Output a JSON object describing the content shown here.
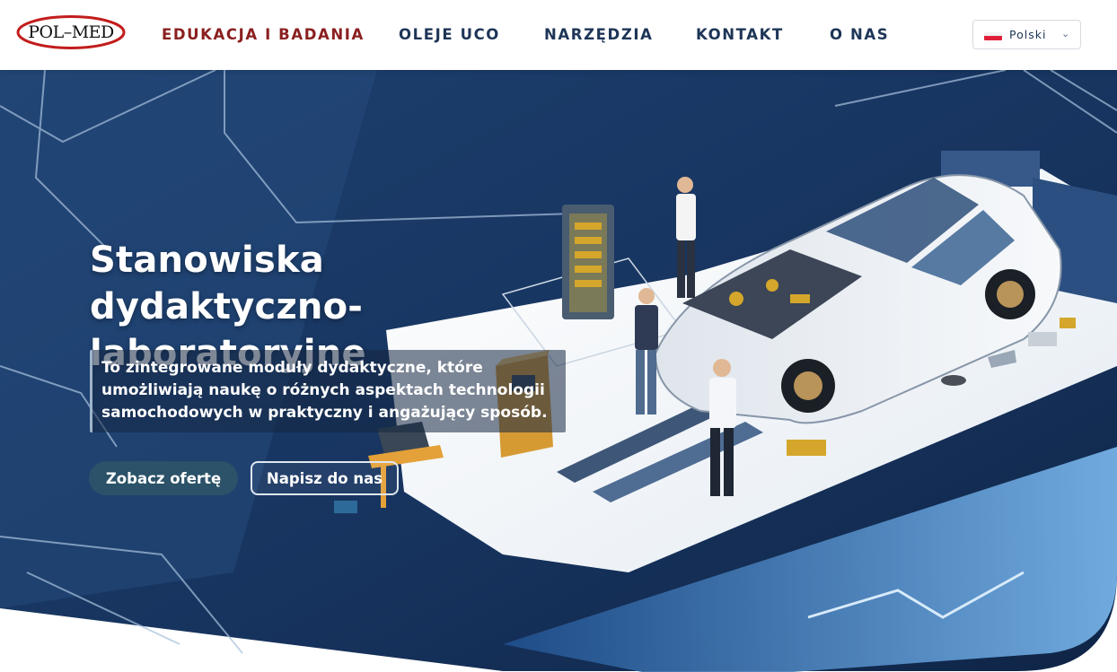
{
  "logo": {
    "text": "POL–MED"
  },
  "nav": {
    "items": [
      {
        "label": "EDUKACJA I BADANIA"
      },
      {
        "label": "OLEJE UCO"
      },
      {
        "label": "NARZĘDZIA"
      },
      {
        "label": "KONTAKT"
      },
      {
        "label": "O NAS"
      }
    ]
  },
  "language": {
    "label": "Polski",
    "flag": "pl-flag-icon"
  },
  "hero": {
    "title": "Stanowiska dydaktyczno-laboratoryjne",
    "subtitle": "To zintegrowane moduły dydaktyczne, które umożliwiają naukę o różnych aspektach technologii samochodowych w praktyczny i angażujący sposób.",
    "primary_button": "Zobacz ofertę",
    "secondary_button": "Napisz do nas"
  },
  "colors": {
    "nav_text": "#1d3557",
    "nav_active": "#8b1f1f",
    "hero_dark": "#16305a",
    "button_primary": "#2b5268",
    "logo_ring": "#c21d1d"
  }
}
